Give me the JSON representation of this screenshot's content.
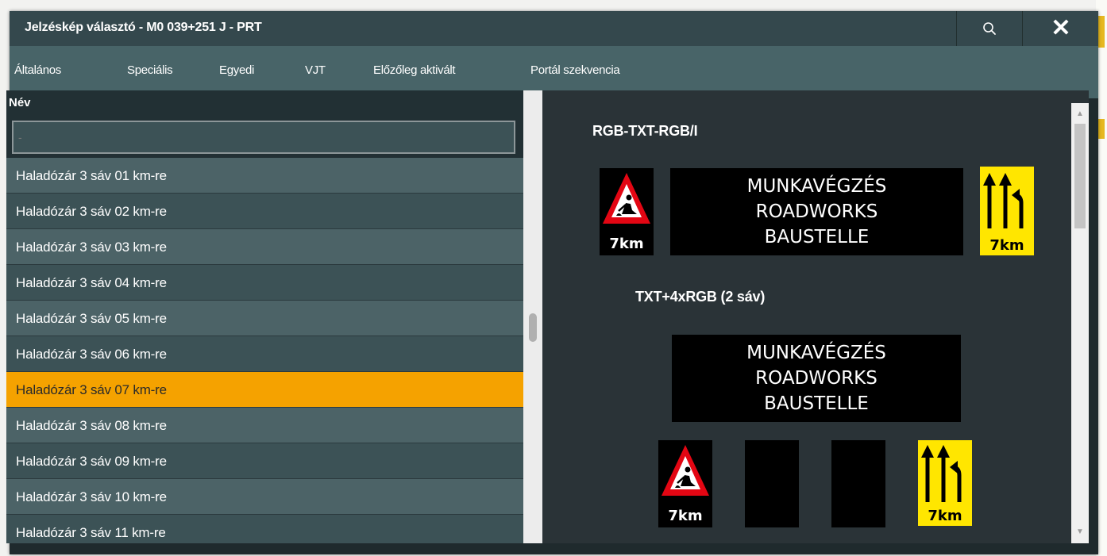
{
  "window": {
    "title": "Jelzéskép választó - M0 039+251 J - PRT",
    "search_icon": "search-icon",
    "close_icon": "close-icon",
    "close_glyph": "✕"
  },
  "tabs": [
    {
      "label": "Általános",
      "active": true
    },
    {
      "label": "Speciális",
      "active": false
    },
    {
      "label": "Egyedi",
      "active": false
    },
    {
      "label": "VJT",
      "active": false
    },
    {
      "label": "Előzőleg aktivált",
      "active": false
    },
    {
      "label": "Portál szekvencia",
      "active": false
    }
  ],
  "list": {
    "header": "Név",
    "filter": {
      "value": "",
      "placeholder": "-"
    },
    "selected_index": 6,
    "items": [
      "Haladózár 3 sáv 01 km-re",
      "Haladózár 3 sáv 02 km-re",
      "Haladózár 3 sáv 03 km-re",
      "Haladózár 3 sáv 04 km-re",
      "Haladózár 3 sáv 05 km-re",
      "Haladózár 3 sáv 06 km-re",
      "Haladózár 3 sáv 07 km-re",
      "Haladózár 3 sáv 08 km-re",
      "Haladózár 3 sáv 09 km-re",
      "Haladózár 3 sáv 10 km-re",
      "Haladózár 3 sáv 11 km-re"
    ]
  },
  "preview": {
    "section1": {
      "title": "RGB-TXT-RGB/I",
      "roadworks_sign_km": "7km",
      "text_lines": [
        "MUNKAVÉGZÉS",
        "ROADWORKS",
        "BAUSTELLE"
      ],
      "lane_sign_km": "7km"
    },
    "section2": {
      "title": "TXT+4xRGB (2 sáv)",
      "text_lines": [
        "MUNKAVÉGZÉS",
        "ROADWORKS",
        "BAUSTELLE"
      ],
      "roadworks_sign_km": "7km",
      "lane_sign_km": "7km"
    }
  },
  "colors": {
    "accent": "#f5a000",
    "titlebar": "#34484d",
    "tabbar": "#486468",
    "row_odd": "#4c6367",
    "row_even": "#3c5256",
    "selected_row": "#f5a200",
    "lane_sign_yellow": "#ffe600",
    "warning_red": "#e30613"
  },
  "icons": {
    "roadworks": "roadworks-warning-icon",
    "lanes": "lane-closure-arrows-icon"
  }
}
